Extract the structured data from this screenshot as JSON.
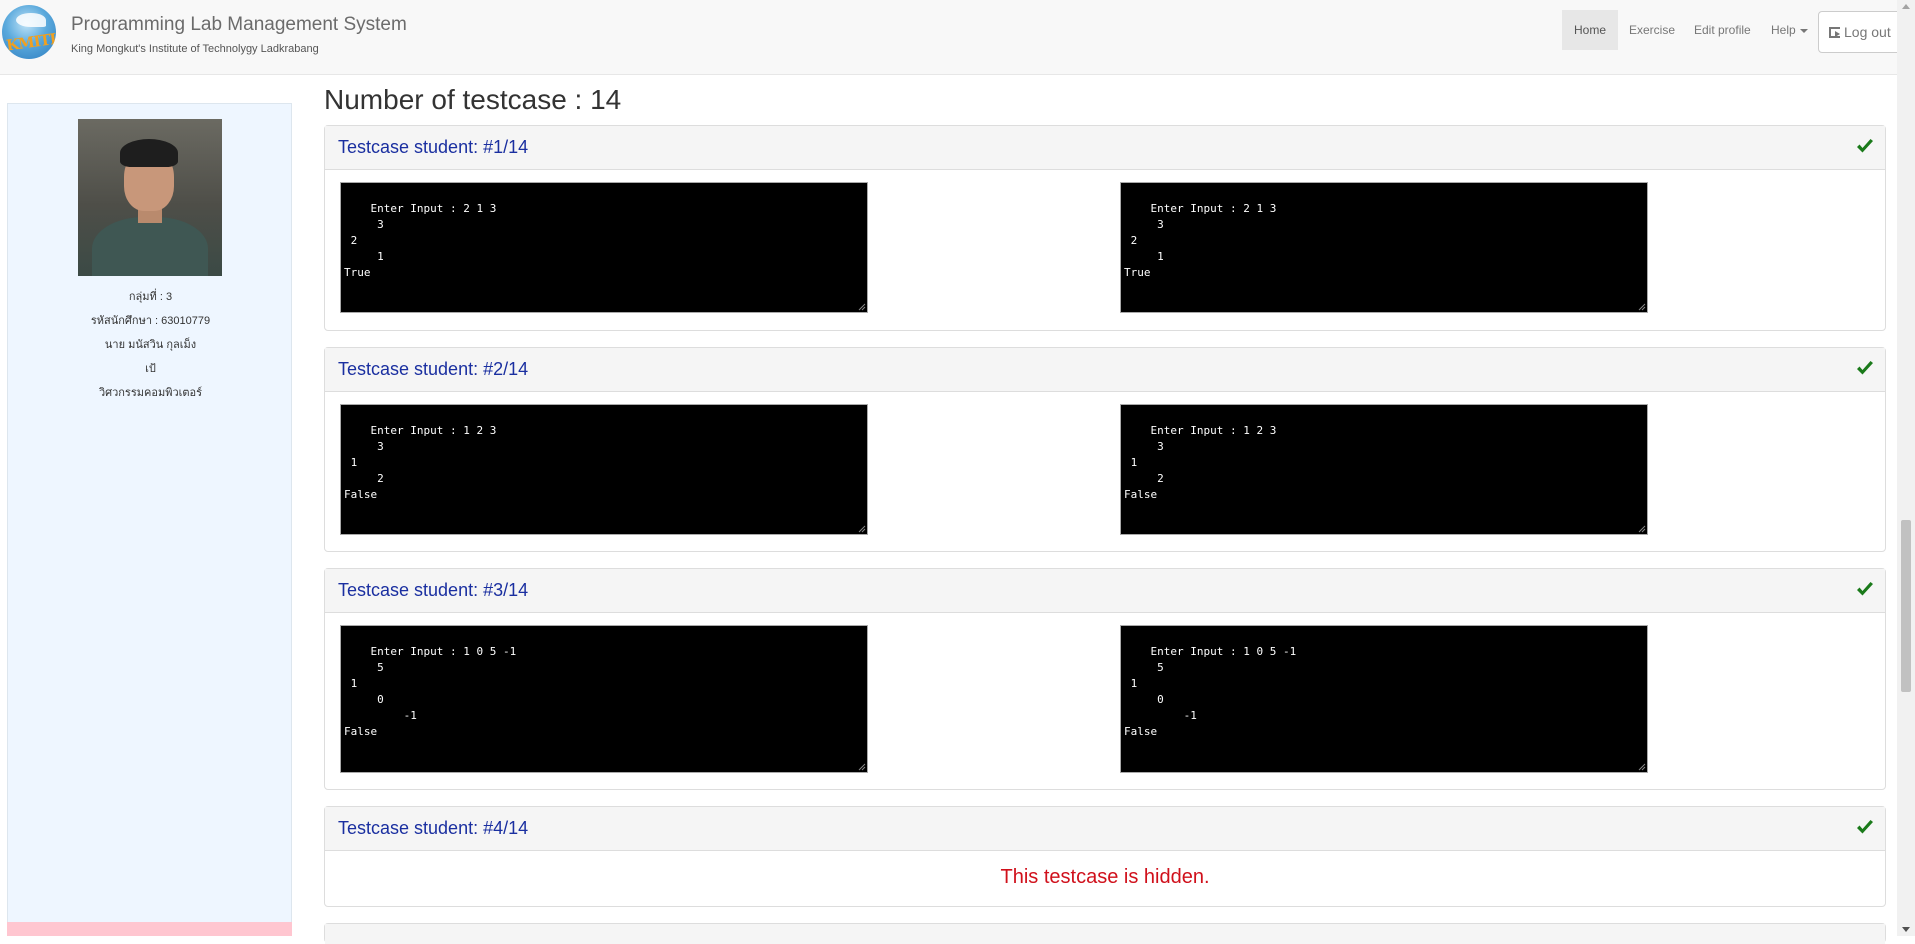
{
  "navbar": {
    "logo_text": "KMITL",
    "brand_title": "Programming Lab Management System",
    "brand_subtitle": "King Mongkut's Institute of Technolygy Ladkrabang",
    "links": [
      "Home",
      "Exercise",
      "Edit profile",
      "Help"
    ],
    "active_link": "Home",
    "logout_label": "Log out"
  },
  "sidebar": {
    "group": "กลุ่มที่ : 3",
    "student_id": "รหัสนักศึกษา : 63010779",
    "name": "นาย มนัสวิน กุลเม็ง",
    "nickname": "เป้",
    "faculty": "วิศวกรรมคอมพิวเตอร์"
  },
  "main": {
    "title": "Number of testcase : 14",
    "testcases": [
      {
        "title": "Testcase student: #1/14",
        "status": "passed",
        "left_output": "Enter Input : 2 1 3\n     3\n 2\n     1\nTrue",
        "right_output": "Enter Input : 2 1 3\n     3\n 2\n     1\nTrue"
      },
      {
        "title": "Testcase student: #2/14",
        "status": "passed",
        "left_output": "Enter Input : 1 2 3\n     3\n 1\n     2\nFalse",
        "right_output": "Enter Input : 1 2 3\n     3\n 1\n     2\nFalse"
      },
      {
        "title": "Testcase student: #3/14",
        "status": "passed",
        "left_output": "Enter Input : 1 0 5 -1\n     5\n 1\n     0\n         -1\nFalse",
        "right_output": "Enter Input : 1 0 5 -1\n     5\n 1\n     0\n         -1\nFalse"
      },
      {
        "title": "Testcase student: #4/14",
        "status": "passed",
        "hidden_message": "This testcase is hidden."
      }
    ]
  },
  "colors": {
    "title_blue": "#1a2fa0",
    "check_green": "#1a7a1a",
    "hidden_red": "#d0101b",
    "sidebar_bg": "#eef6ff",
    "terminal_bg": "#000000"
  },
  "icons": [
    "check-icon",
    "logout-icon",
    "caret-down-icon"
  ]
}
